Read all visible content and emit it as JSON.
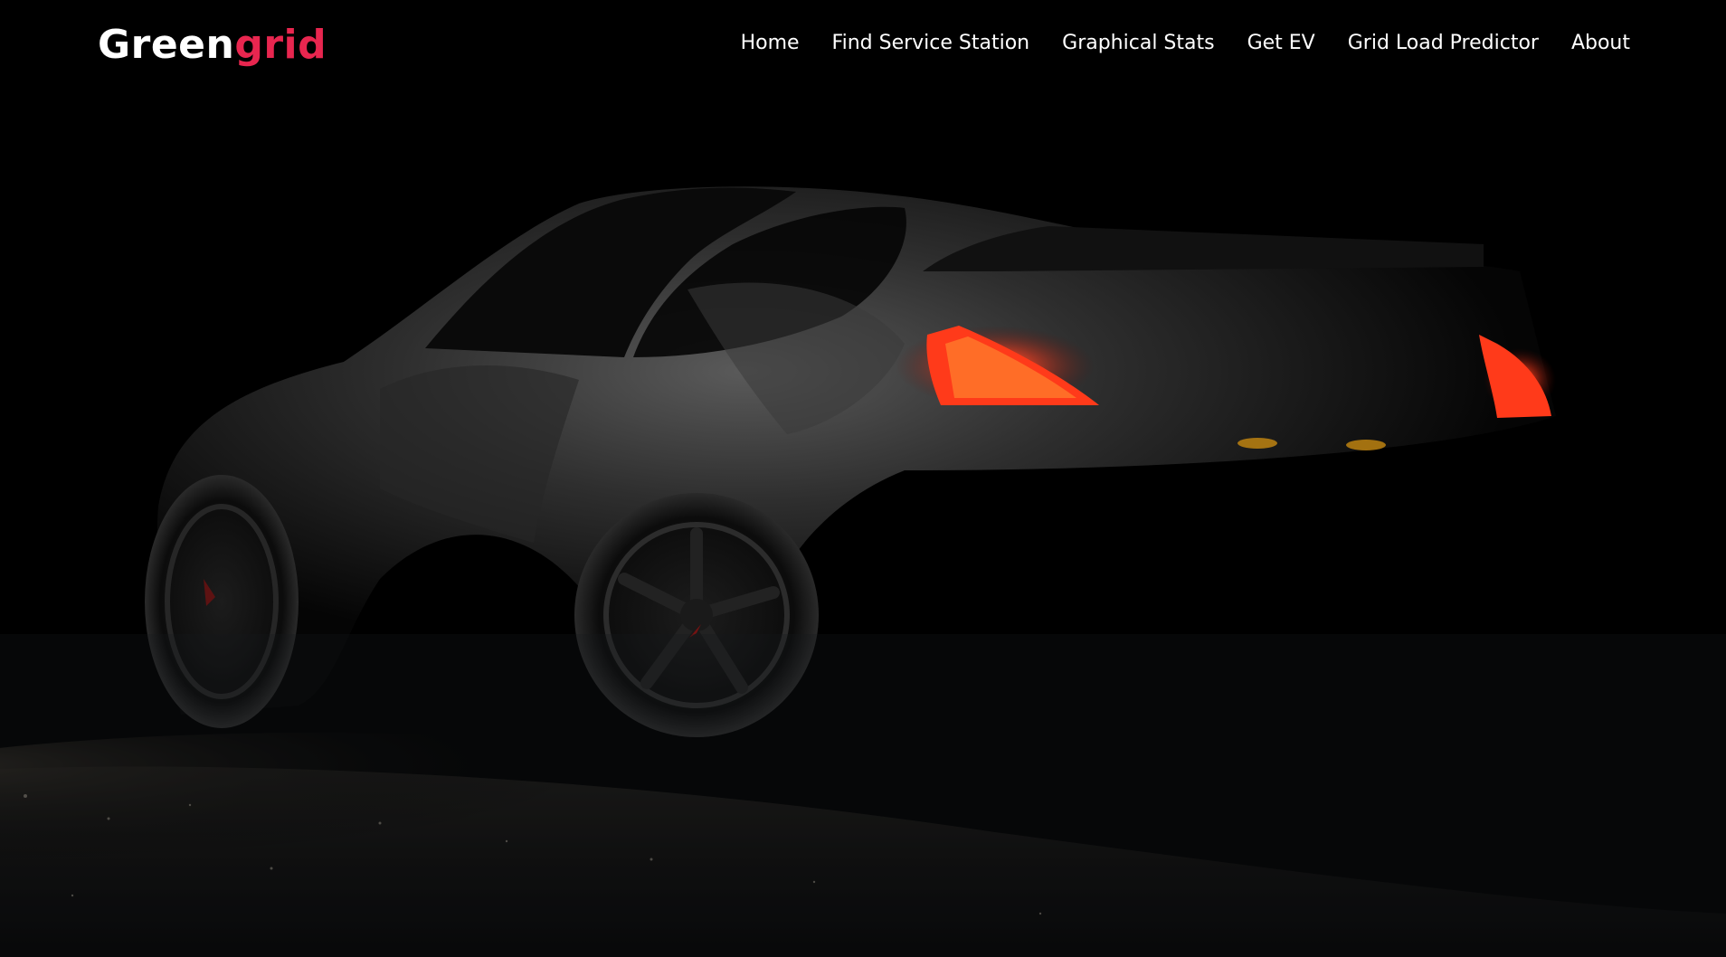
{
  "brand": {
    "name_part1": "Green",
    "name_part2": "grid",
    "accent_color": "#e8264f"
  },
  "nav": {
    "items": [
      {
        "label": "Home"
      },
      {
        "label": "Find Service Station"
      },
      {
        "label": "Graphical Stats"
      },
      {
        "label": "Get EV"
      },
      {
        "label": "Grid Load Predictor"
      },
      {
        "label": "About"
      }
    ]
  },
  "hero": {
    "image": "dark-sports-car-photo",
    "taillight_color": "#ff3a1a"
  }
}
